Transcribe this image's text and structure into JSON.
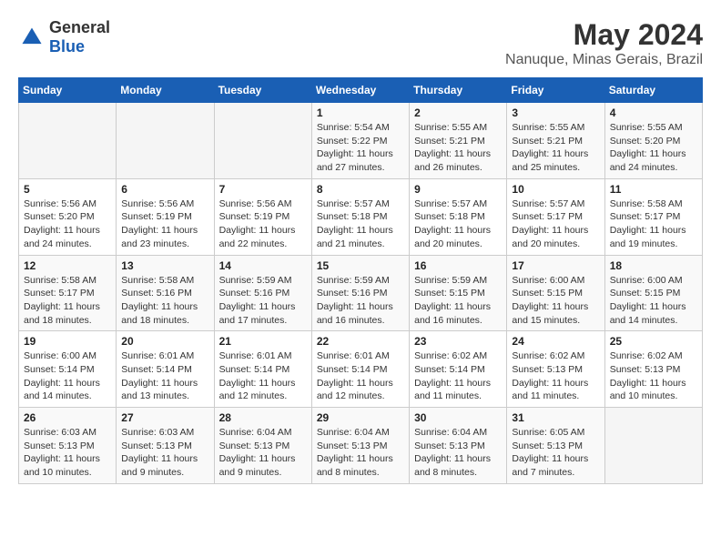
{
  "header": {
    "logo": {
      "general": "General",
      "blue": "Blue"
    },
    "title": "May 2024",
    "subtitle": "Nanuque, Minas Gerais, Brazil"
  },
  "weekdays": [
    "Sunday",
    "Monday",
    "Tuesday",
    "Wednesday",
    "Thursday",
    "Friday",
    "Saturday"
  ],
  "weeks": [
    [
      {
        "day": "",
        "info": ""
      },
      {
        "day": "",
        "info": ""
      },
      {
        "day": "",
        "info": ""
      },
      {
        "day": "1",
        "info": "Sunrise: 5:54 AM\nSunset: 5:22 PM\nDaylight: 11 hours\nand 27 minutes."
      },
      {
        "day": "2",
        "info": "Sunrise: 5:55 AM\nSunset: 5:21 PM\nDaylight: 11 hours\nand 26 minutes."
      },
      {
        "day": "3",
        "info": "Sunrise: 5:55 AM\nSunset: 5:21 PM\nDaylight: 11 hours\nand 25 minutes."
      },
      {
        "day": "4",
        "info": "Sunrise: 5:55 AM\nSunset: 5:20 PM\nDaylight: 11 hours\nand 24 minutes."
      }
    ],
    [
      {
        "day": "5",
        "info": "Sunrise: 5:56 AM\nSunset: 5:20 PM\nDaylight: 11 hours\nand 24 minutes."
      },
      {
        "day": "6",
        "info": "Sunrise: 5:56 AM\nSunset: 5:19 PM\nDaylight: 11 hours\nand 23 minutes."
      },
      {
        "day": "7",
        "info": "Sunrise: 5:56 AM\nSunset: 5:19 PM\nDaylight: 11 hours\nand 22 minutes."
      },
      {
        "day": "8",
        "info": "Sunrise: 5:57 AM\nSunset: 5:18 PM\nDaylight: 11 hours\nand 21 minutes."
      },
      {
        "day": "9",
        "info": "Sunrise: 5:57 AM\nSunset: 5:18 PM\nDaylight: 11 hours\nand 20 minutes."
      },
      {
        "day": "10",
        "info": "Sunrise: 5:57 AM\nSunset: 5:17 PM\nDaylight: 11 hours\nand 20 minutes."
      },
      {
        "day": "11",
        "info": "Sunrise: 5:58 AM\nSunset: 5:17 PM\nDaylight: 11 hours\nand 19 minutes."
      }
    ],
    [
      {
        "day": "12",
        "info": "Sunrise: 5:58 AM\nSunset: 5:17 PM\nDaylight: 11 hours\nand 18 minutes."
      },
      {
        "day": "13",
        "info": "Sunrise: 5:58 AM\nSunset: 5:16 PM\nDaylight: 11 hours\nand 18 minutes."
      },
      {
        "day": "14",
        "info": "Sunrise: 5:59 AM\nSunset: 5:16 PM\nDaylight: 11 hours\nand 17 minutes."
      },
      {
        "day": "15",
        "info": "Sunrise: 5:59 AM\nSunset: 5:16 PM\nDaylight: 11 hours\nand 16 minutes."
      },
      {
        "day": "16",
        "info": "Sunrise: 5:59 AM\nSunset: 5:15 PM\nDaylight: 11 hours\nand 16 minutes."
      },
      {
        "day": "17",
        "info": "Sunrise: 6:00 AM\nSunset: 5:15 PM\nDaylight: 11 hours\nand 15 minutes."
      },
      {
        "day": "18",
        "info": "Sunrise: 6:00 AM\nSunset: 5:15 PM\nDaylight: 11 hours\nand 14 minutes."
      }
    ],
    [
      {
        "day": "19",
        "info": "Sunrise: 6:00 AM\nSunset: 5:14 PM\nDaylight: 11 hours\nand 14 minutes."
      },
      {
        "day": "20",
        "info": "Sunrise: 6:01 AM\nSunset: 5:14 PM\nDaylight: 11 hours\nand 13 minutes."
      },
      {
        "day": "21",
        "info": "Sunrise: 6:01 AM\nSunset: 5:14 PM\nDaylight: 11 hours\nand 12 minutes."
      },
      {
        "day": "22",
        "info": "Sunrise: 6:01 AM\nSunset: 5:14 PM\nDaylight: 11 hours\nand 12 minutes."
      },
      {
        "day": "23",
        "info": "Sunrise: 6:02 AM\nSunset: 5:14 PM\nDaylight: 11 hours\nand 11 minutes."
      },
      {
        "day": "24",
        "info": "Sunrise: 6:02 AM\nSunset: 5:13 PM\nDaylight: 11 hours\nand 11 minutes."
      },
      {
        "day": "25",
        "info": "Sunrise: 6:02 AM\nSunset: 5:13 PM\nDaylight: 11 hours\nand 10 minutes."
      }
    ],
    [
      {
        "day": "26",
        "info": "Sunrise: 6:03 AM\nSunset: 5:13 PM\nDaylight: 11 hours\nand 10 minutes."
      },
      {
        "day": "27",
        "info": "Sunrise: 6:03 AM\nSunset: 5:13 PM\nDaylight: 11 hours\nand 9 minutes."
      },
      {
        "day": "28",
        "info": "Sunrise: 6:04 AM\nSunset: 5:13 PM\nDaylight: 11 hours\nand 9 minutes."
      },
      {
        "day": "29",
        "info": "Sunrise: 6:04 AM\nSunset: 5:13 PM\nDaylight: 11 hours\nand 8 minutes."
      },
      {
        "day": "30",
        "info": "Sunrise: 6:04 AM\nSunset: 5:13 PM\nDaylight: 11 hours\nand 8 minutes."
      },
      {
        "day": "31",
        "info": "Sunrise: 6:05 AM\nSunset: 5:13 PM\nDaylight: 11 hours\nand 7 minutes."
      },
      {
        "day": "",
        "info": ""
      }
    ]
  ]
}
